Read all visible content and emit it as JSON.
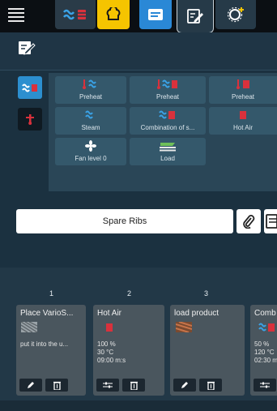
{
  "grid": {
    "row1": [
      "Preheat",
      "Preheat",
      "Preheat"
    ],
    "row2": [
      "Steam",
      "Combination of s...",
      "Hot Air"
    ],
    "row3": [
      "Fan level 0",
      "Load"
    ]
  },
  "name_field": {
    "value": "Spare Ribs"
  },
  "steps": {
    "numbers": [
      "1",
      "2",
      "3"
    ],
    "cards": [
      {
        "title": "Place VarioS...",
        "info": [
          "put it into the u..."
        ]
      },
      {
        "title": "Hot Air",
        "info": [
          "100 %",
          "30 °C",
          "09:00 m:s"
        ]
      },
      {
        "title": "load product",
        "info": []
      },
      {
        "title": "Comb",
        "info": [
          "50 %",
          "120 °C",
          "02:30 m"
        ]
      }
    ]
  },
  "colors": {
    "accent_blue": "#2c8fcf",
    "yellow_tab": "#f5c400",
    "blue_tab": "#2a88d6",
    "heat_red": "#d9313c",
    "steam_blue": "#3aa2e6"
  }
}
